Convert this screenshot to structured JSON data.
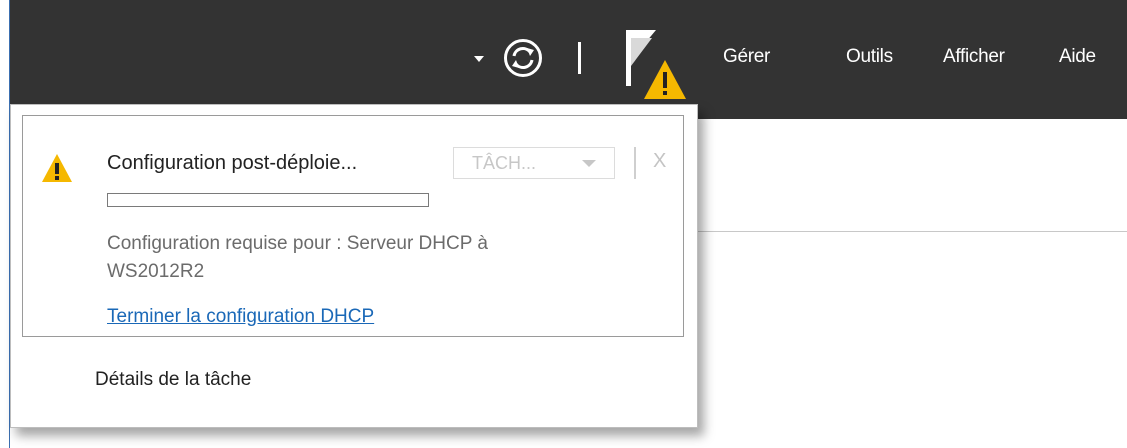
{
  "header": {
    "menu": [
      {
        "label": "Gérer"
      },
      {
        "label": "Outils"
      },
      {
        "label": "Afficher"
      },
      {
        "label": "Aide"
      }
    ],
    "icons": {
      "dropdown": "chevron-down-icon",
      "refresh": "refresh-icon",
      "notifications": "flag-warning-icon"
    }
  },
  "notification": {
    "title": "Configuration post-déploie...",
    "task_button": "TÂCH...",
    "close": "X",
    "progress": 0,
    "description": "Configuration requise pour : Serveur DHCP à WS2012R2",
    "link": "Terminer la configuration DHCP",
    "icon": "warning-icon"
  },
  "task_details": "Détails de la tâche",
  "colors": {
    "topbar": "#333333",
    "warning": "#f5b800",
    "link": "#1a68b7"
  }
}
